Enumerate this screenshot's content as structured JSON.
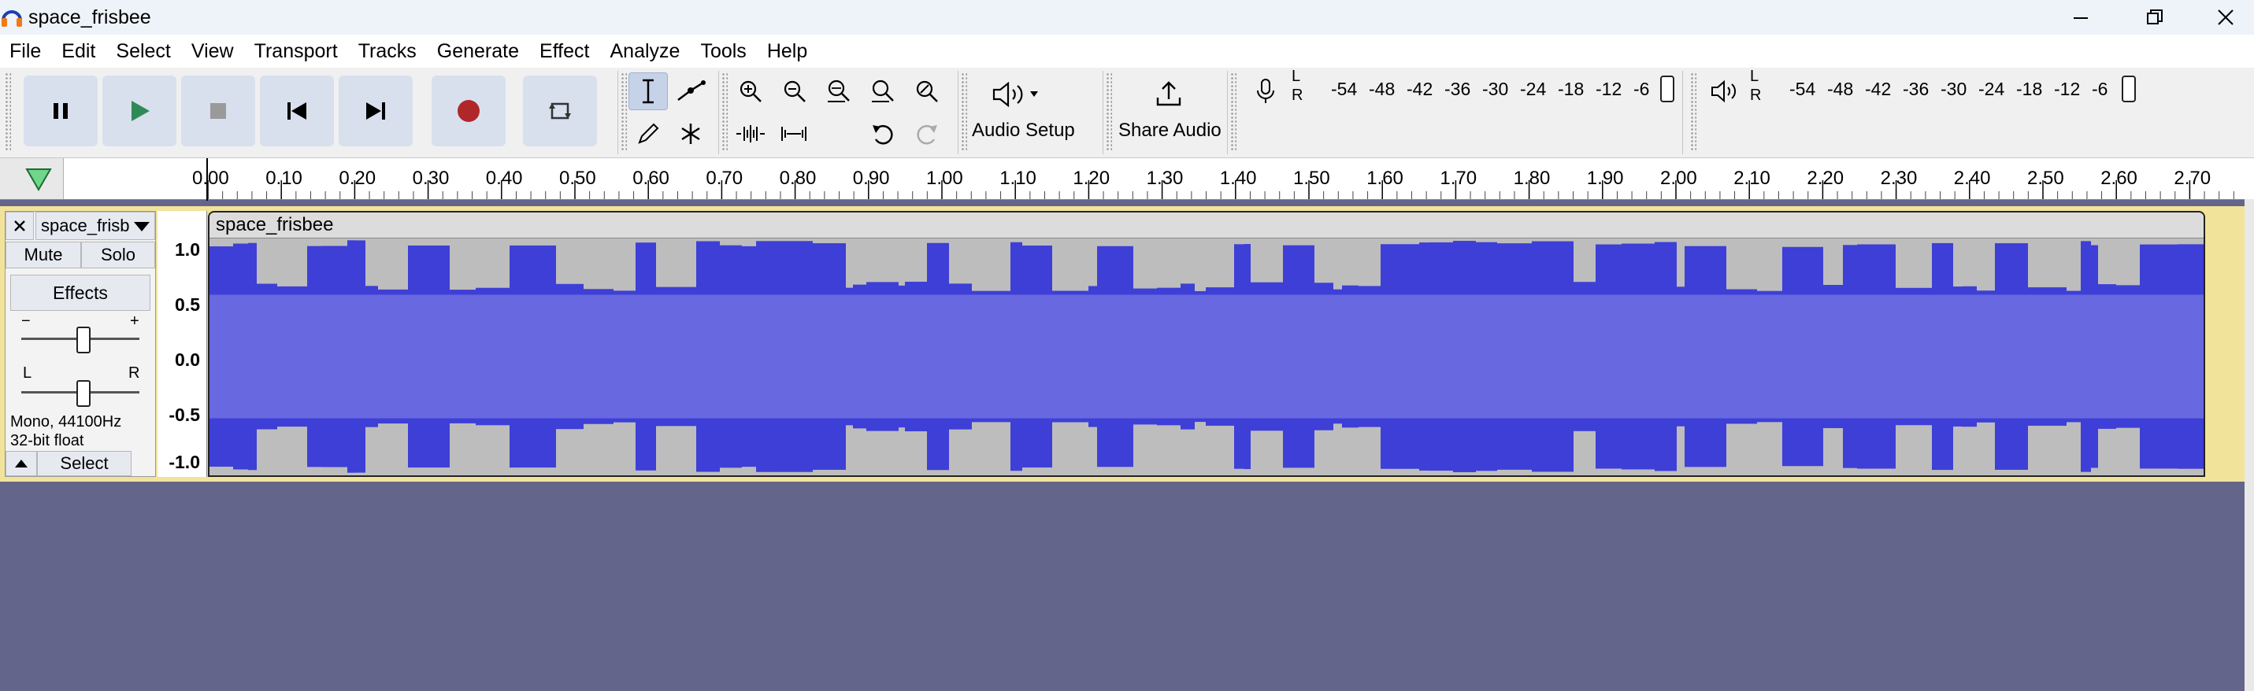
{
  "window": {
    "title": "space_frisbee"
  },
  "menu": [
    "File",
    "Edit",
    "Select",
    "View",
    "Transport",
    "Tracks",
    "Generate",
    "Effect",
    "Analyze",
    "Tools",
    "Help"
  ],
  "toolbar": {
    "audio_setup_label": "Audio Setup",
    "share_audio_label": "Share Audio",
    "record_meter": {
      "l": "L",
      "r": "R",
      "scale": [
        "-54",
        "-48",
        "-42",
        "-36",
        "-30",
        "-24",
        "-18",
        "-12",
        "-6"
      ]
    },
    "play_meter": {
      "l": "L",
      "r": "R",
      "scale": [
        "-54",
        "-48",
        "-42",
        "-36",
        "-30",
        "-24",
        "-18",
        "-12",
        "-6"
      ]
    }
  },
  "ruler": {
    "ticks": [
      "0.00",
      "0.10",
      "0.20",
      "0.30",
      "0.40",
      "0.50",
      "0.60",
      "0.70",
      "0.80",
      "0.90",
      "1.00",
      "1.10",
      "1.20",
      "1.30",
      "1.40",
      "1.50",
      "1.60",
      "1.70",
      "1.80",
      "1.90",
      "2.00",
      "2.10",
      "2.20",
      "2.30",
      "2.40",
      "2.50",
      "2.60",
      "2.70"
    ]
  },
  "track": {
    "name": "space_frisb",
    "mute_label": "Mute",
    "solo_label": "Solo",
    "effects_label": "Effects",
    "gain_minus": "−",
    "gain_plus": "+",
    "pan_left": "L",
    "pan_right": "R",
    "info_line1": "Mono, 44100Hz",
    "info_line2": "32-bit float",
    "select_label": "Select",
    "clip_name": "space_frisbee",
    "scale": [
      "1.0",
      "0.5",
      "0.0",
      "-0.5",
      "-1.0"
    ]
  },
  "colors": {
    "waveform": "#3e3fd6",
    "waveform_rms": "#6868e0",
    "clip_background": "#bdbdbd",
    "track_background": "#63668a",
    "selected_track_border": "#f2e39a",
    "record_red": "#b0272a",
    "play_green": "#2e8b57"
  }
}
